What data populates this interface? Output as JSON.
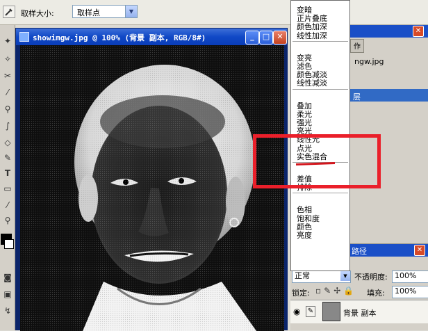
{
  "options_bar": {
    "sample_size_label": "取样大小:",
    "sample_size_value": "取样点"
  },
  "document": {
    "title": "showimgw.jpg @ 100% (背景 副本, RGB/8#)"
  },
  "blend_menu": {
    "groups": [
      [
        "变暗",
        "正片叠底",
        "颜色加深",
        "线性加深"
      ],
      [
        "变亮",
        "滤色",
        "颜色减淡",
        "线性减淡"
      ],
      [
        "叠加",
        "柔光",
        "强光",
        "亮光",
        "线性光",
        "点光",
        "实色混合"
      ],
      [
        "差值",
        "排除"
      ],
      [
        "色相",
        "饱和度",
        "颜色",
        "亮度"
      ]
    ],
    "highlighted_item": "线性光"
  },
  "right_panel": {
    "tab_label": "作",
    "file_name": "ngw.jpg",
    "selected_label": "层"
  },
  "layers_panel": {
    "tab_label": "路径",
    "blend_mode_value": "正常",
    "opacity_label": "不透明度:",
    "opacity_value": "100%",
    "lock_label": "锁定:",
    "fill_label": "填充:",
    "fill_value": "100%",
    "layer_name": "背景 副本"
  },
  "annotation": {
    "color": "#ea1f2a"
  }
}
